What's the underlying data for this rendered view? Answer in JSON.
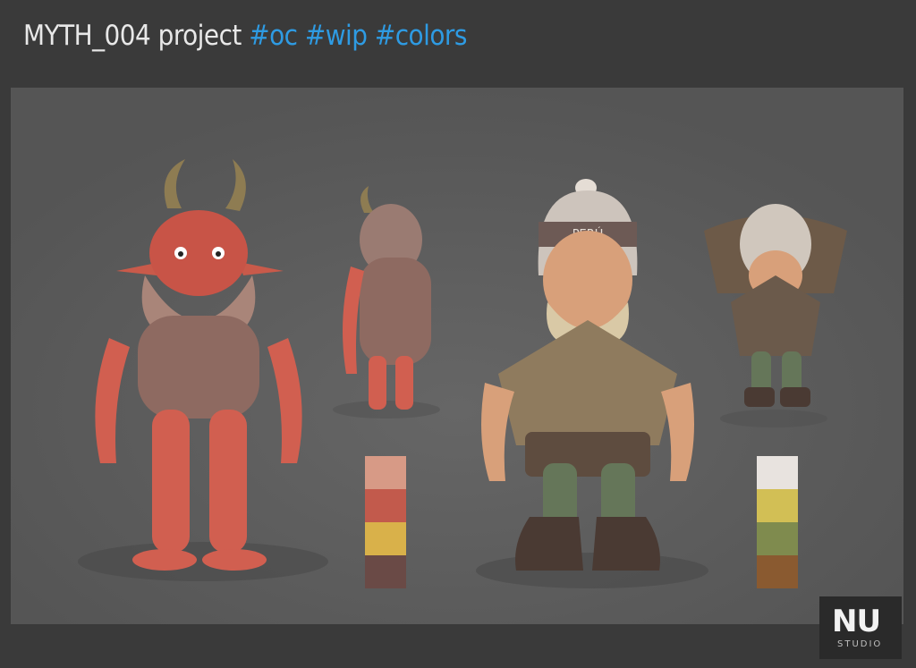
{
  "header": {
    "title": "MYTH_004 project",
    "tags": "#oc #wip #colors"
  },
  "characters": [
    {
      "name": "red-troll",
      "palette": [
        "#d79a86",
        "#c25a4c",
        "#d9b14a",
        "#6a4a46"
      ]
    },
    {
      "name": "gnome-peru",
      "hat_text": "PERÚ",
      "palette": [
        "#e8e3df",
        "#d2bf55",
        "#7f8b4e",
        "#8a5a30"
      ]
    }
  ],
  "logo": {
    "mark": "NU",
    "sub": "STUDIO"
  }
}
